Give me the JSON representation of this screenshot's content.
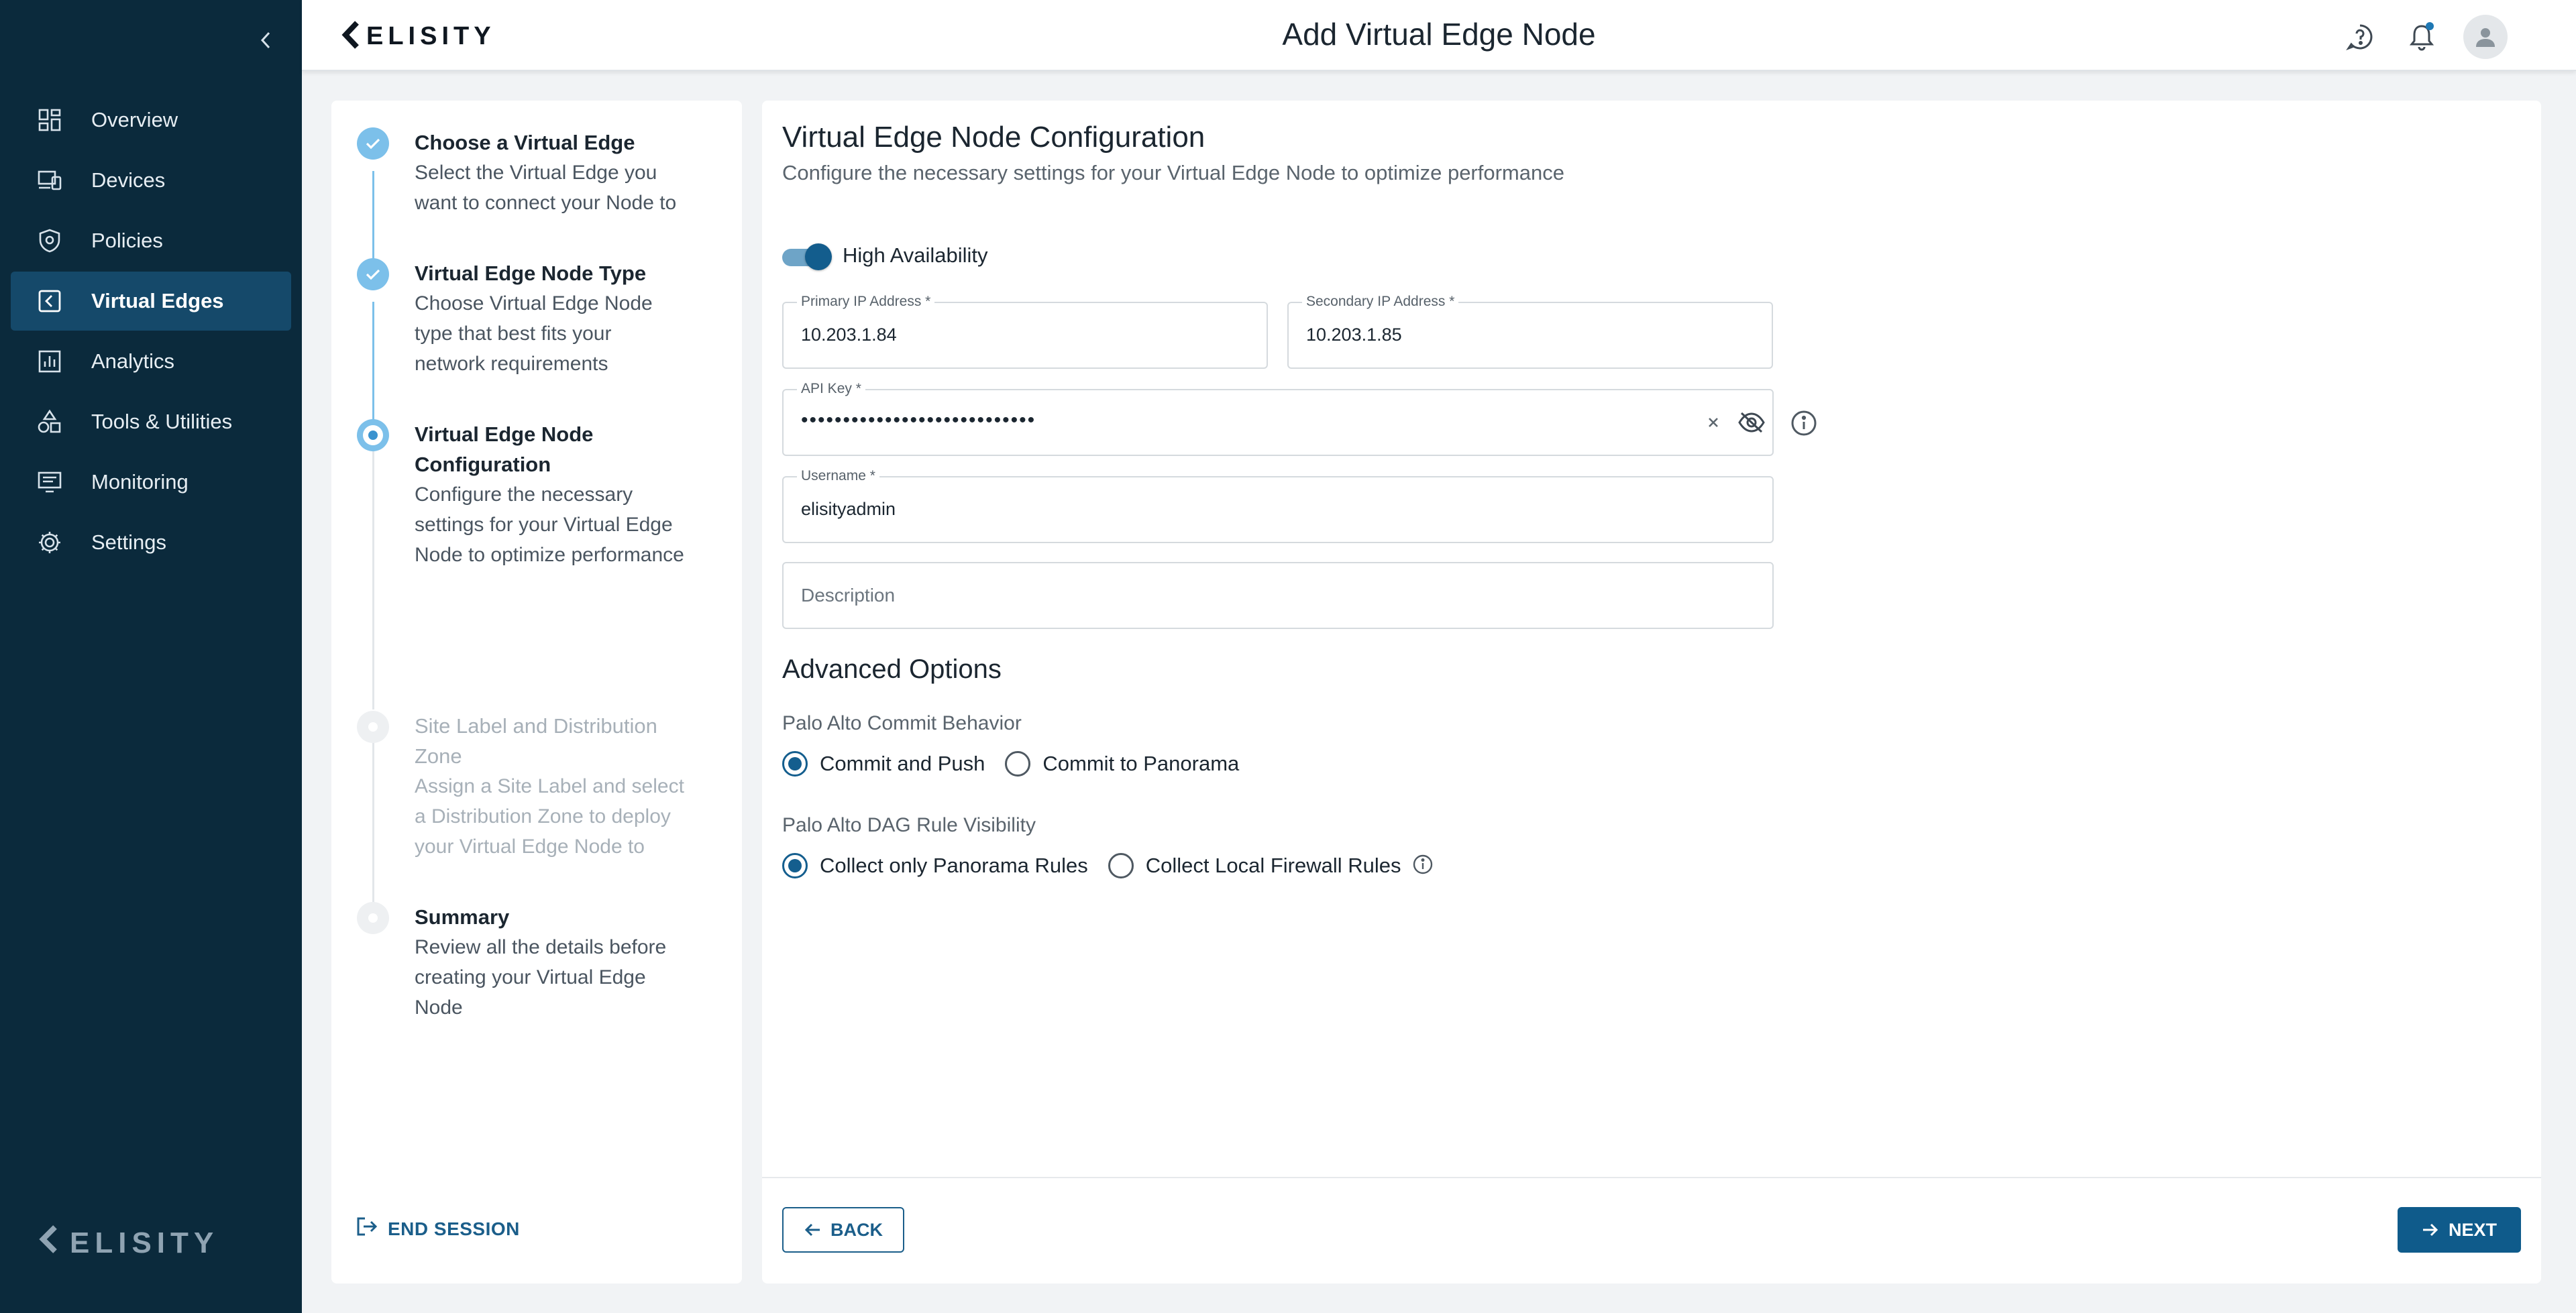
{
  "app": {
    "brand": "ELISITY",
    "page_title": "Add Virtual Edge Node"
  },
  "sidebar": {
    "items": [
      {
        "label": "Overview",
        "icon": "dashboard-icon",
        "active": false
      },
      {
        "label": "Devices",
        "icon": "devices-icon",
        "active": false
      },
      {
        "label": "Policies",
        "icon": "shield-icon",
        "active": false
      },
      {
        "label": "Virtual Edges",
        "icon": "virtual-edge-icon",
        "active": true
      },
      {
        "label": "Analytics",
        "icon": "bar-chart-icon",
        "active": false
      },
      {
        "label": "Tools & Utilities",
        "icon": "tools-icon",
        "active": false
      },
      {
        "label": "Monitoring",
        "icon": "monitor-icon",
        "active": false
      },
      {
        "label": "Settings",
        "icon": "gear-icon",
        "active": false
      }
    ],
    "logo": "ELISITY"
  },
  "stepper": {
    "steps": [
      {
        "title": "Choose a Virtual Edge",
        "desc": [
          "Select the Virtual Edge you",
          "want to connect your Node to"
        ],
        "state": "done"
      },
      {
        "title": "Virtual Edge Node Type",
        "desc": [
          "Choose Virtual Edge Node",
          "type that best fits your",
          "network requirements"
        ],
        "state": "done"
      },
      {
        "title": [
          "Virtual Edge Node",
          "Configuration"
        ],
        "desc": [
          "Configure the necessary",
          "settings for your Virtual Edge",
          "Node to optimize performance"
        ],
        "state": "current"
      },
      {
        "title": [
          "Site Label and Distribution",
          "Zone"
        ],
        "desc": [
          "Assign a Site Label and select",
          "a Distribution Zone to deploy",
          "your Virtual Edge Node to"
        ],
        "state": "todo"
      },
      {
        "title": "Summary",
        "desc": [
          "Review all the details before",
          "creating your Virtual Edge",
          "Node"
        ],
        "state": "todo"
      }
    ],
    "end_session": "END SESSION"
  },
  "form": {
    "title": "Virtual Edge Node Configuration",
    "subtitle": "Configure the necessary settings for your Virtual Edge Node to optimize performance",
    "high_availability": {
      "label": "High Availability",
      "enabled": true
    },
    "primary_ip": {
      "label": "Primary IP Address *",
      "value": "10.203.1.84"
    },
    "secondary_ip": {
      "label": "Secondary IP Address *",
      "value": "10.203.1.85"
    },
    "api_key": {
      "label": "API Key *",
      "value": "••••••••••••••••••••••••••••"
    },
    "username": {
      "label": "Username *",
      "value": "elisityadmin"
    },
    "description": {
      "placeholder": "Description"
    },
    "advanced_title": "Advanced Options",
    "commit_behavior": {
      "label": "Palo Alto Commit Behavior",
      "options": [
        "Commit and Push",
        "Commit to Panorama"
      ],
      "selected": 0
    },
    "dag_visibility": {
      "label": "Palo Alto DAG Rule Visibility",
      "options": [
        "Collect only Panorama Rules",
        "Collect Local Firewall Rules"
      ],
      "selected": 0
    }
  },
  "footer": {
    "back": "BACK",
    "next": "NEXT"
  },
  "colors": {
    "sidebar_bg": "#0b2a3c",
    "sidebar_active": "#15496a",
    "accent": "#0f5b8b",
    "step_done": "#7cc0ea"
  }
}
